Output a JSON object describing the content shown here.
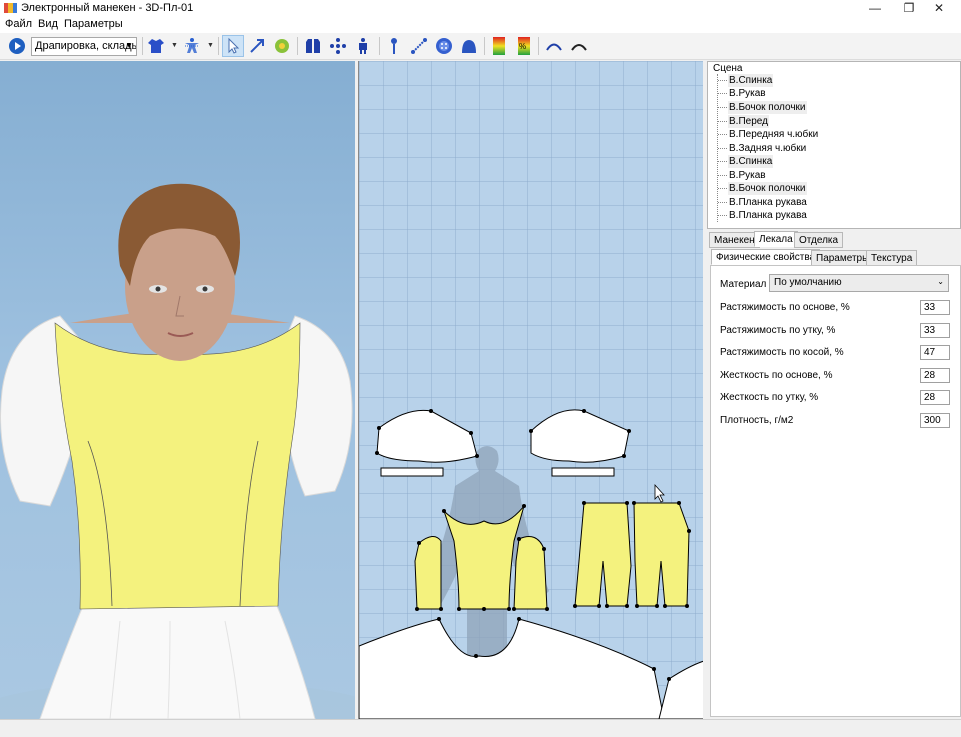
{
  "window": {
    "title": "Электронный манекен - 3D-Пл-01",
    "minimize": "—",
    "restore": "❐",
    "close": "✕"
  },
  "menu": [
    "Файл",
    "Вид",
    "Параметры"
  ],
  "toolbar": {
    "mode_select": "Драпировка, склады",
    "icons": [
      "play-icon",
      "shirt-icon",
      "mannequin-icon",
      "pointer-icon",
      "arrow-tool-icon",
      "flower-icon",
      "garment-icon",
      "points-icon",
      "figure-icon",
      "pin-icon",
      "measure-icon",
      "button-icon",
      "hat-icon",
      "gradient-red-icon",
      "gradient-percent-icon",
      "arc-left-icon",
      "arc-right-icon"
    ],
    "accent": "#1e5fc0"
  },
  "scene": {
    "root": "Сцена",
    "items": [
      "В.Спинка",
      "В.Рукав",
      "В.Бочок полочки",
      "В.Перед",
      "В.Передняя ч.юбки",
      "В.Задняя ч.юбки",
      "В.Спинка",
      "В.Рукав",
      "В.Бочок полочки",
      "В.Планка рукава",
      "В.Планка рукава"
    ]
  },
  "tabs_main": [
    "Манекен",
    "Лекала",
    "Отделка"
  ],
  "tabs_sub": [
    "Физические свойства",
    "Параметры",
    "Текстура"
  ],
  "properties": {
    "material_label": "Материал",
    "material_value": "По умолчанию",
    "rows": [
      {
        "label": "Растяжимость по основе, %",
        "value": "33"
      },
      {
        "label": "Растяжимость по утку, %",
        "value": "33"
      },
      {
        "label": "Растяжимость по косой, %",
        "value": "47"
      },
      {
        "label": "Жесткость по основе, %",
        "value": "28"
      },
      {
        "label": "Жесткость по утку, %",
        "value": "28"
      },
      {
        "label": "Плотность, г/м2",
        "value": "300"
      }
    ]
  },
  "colors": {
    "bodice": "#f4f27e",
    "skin": "#c9a08a",
    "hair": "#8a5a34",
    "background": "#9dc0df"
  }
}
